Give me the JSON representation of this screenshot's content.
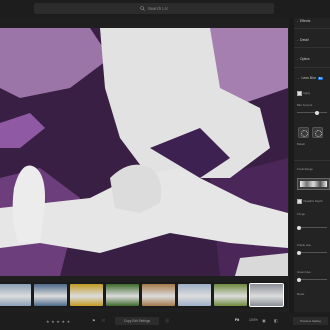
{
  "search": {
    "placeholder": "Search Lrc"
  },
  "panel": {
    "sections": [
      {
        "label": "Effects"
      },
      {
        "label": "Detail"
      },
      {
        "label": "Optics"
      },
      {
        "label": "Lens Blur",
        "badge": "EA"
      }
    ],
    "apply_label": "Apply",
    "blur_amount_label": "Blur Amount",
    "bokeh_label": "Bokeh",
    "focal_range_label": "Focal Range",
    "visualize_depth_label": "Visualize Depth",
    "fringe_labels": [
      "Fringe",
      "Purple Hue",
      "Green Hue"
    ],
    "reset_label": "Reset"
  },
  "filmstrip": {
    "thumbs": [
      {
        "name": "thumb-1",
        "color": "#8aa0b8"
      },
      {
        "name": "thumb-2",
        "color": "#4d6b8a"
      },
      {
        "name": "thumb-3",
        "color": "#c29a23"
      },
      {
        "name": "thumb-4",
        "color": "#3e6a2d"
      },
      {
        "name": "thumb-5",
        "color": "#a47a49"
      },
      {
        "name": "thumb-6",
        "color": "#9db0c8"
      },
      {
        "name": "thumb-7",
        "color": "#6e8a3d"
      },
      {
        "name": "thumb-8",
        "color": "#8a8f97",
        "selected": true
      }
    ]
  },
  "bottom": {
    "edit_settings_label": "Copy Edit Settings",
    "fit_label": "Fit",
    "zoom_label": "100%",
    "right_label": "Previous Setting"
  },
  "colors": {
    "accent": "#1473e6",
    "purple": "#6a2f7e",
    "white_mask": "#e3e3e3"
  }
}
